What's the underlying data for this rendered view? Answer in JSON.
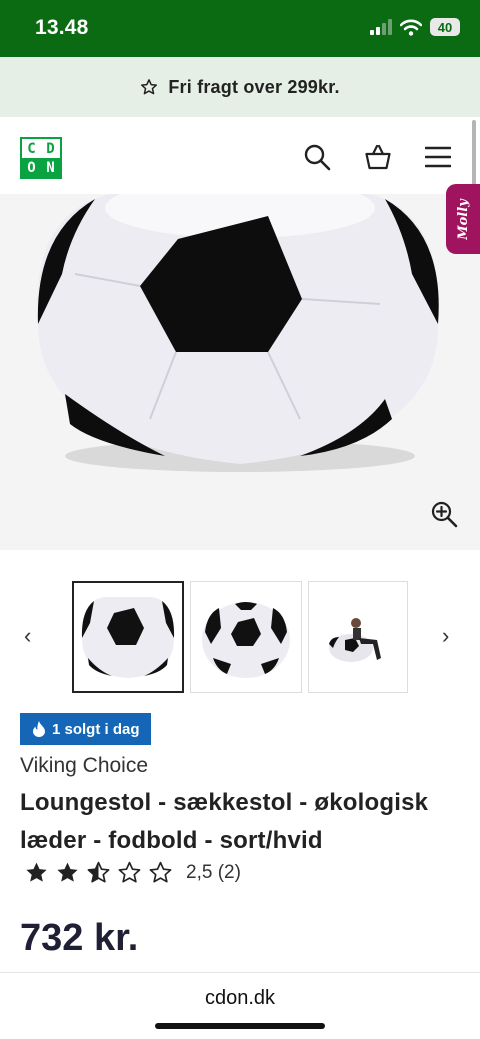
{
  "status": {
    "time": "13.48",
    "battery": "40"
  },
  "promo": {
    "text": "Fri fragt over 299kr."
  },
  "header": {
    "logo_letters": [
      "C",
      "D",
      "O",
      "N"
    ],
    "icons": [
      "search-icon",
      "basket-icon",
      "menu-icon"
    ]
  },
  "chat_tab": {
    "label": "Molly"
  },
  "gallery": {
    "thumbnails": 3,
    "active_index": 0
  },
  "product": {
    "badge": "1 solgt i dag",
    "brand": "Viking Choice",
    "title": "Loungestol - sækkestol - økologisk læder - fodbold - sort/hvid",
    "rating": 2.5,
    "rating_max": 5,
    "rating_text": "2,5 (2)",
    "price": "732 kr."
  },
  "browser": {
    "url": "cdon.dk"
  },
  "colors": {
    "status_green": "#0b6b12",
    "brand_green": "#0aa341",
    "badge_blue": "#1566b7",
    "chat_magenta": "#a0135f"
  }
}
